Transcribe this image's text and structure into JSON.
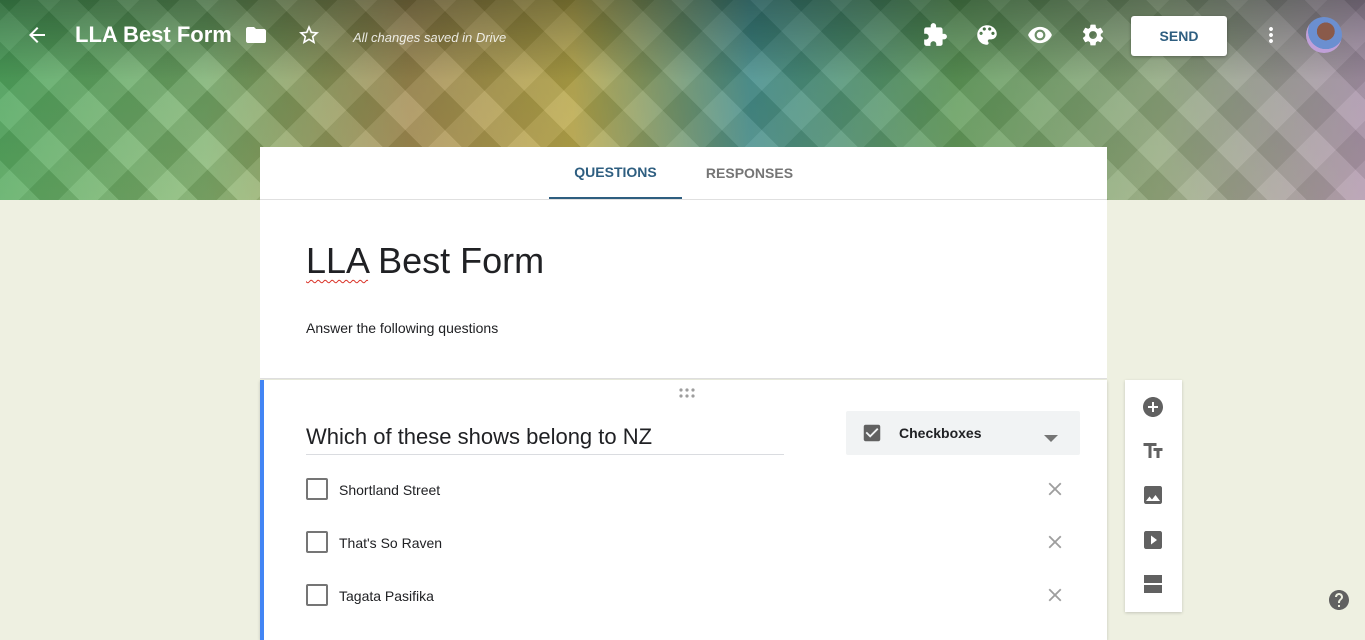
{
  "header": {
    "app_title": "LLA Best Form",
    "saved_status": "All changes saved in Drive",
    "send_label": "SEND",
    "icons": [
      "back-arrow-icon",
      "folder-icon",
      "star-icon",
      "addons-icon",
      "palette-icon",
      "preview-eye-icon",
      "settings-gear-icon",
      "more-vert-icon"
    ]
  },
  "tabs": [
    {
      "label": "QUESTIONS",
      "active": true
    },
    {
      "label": "RESPONSES",
      "active": false
    }
  ],
  "form": {
    "title_part1": "LLA",
    "title_part2": " Best Form",
    "description": "Answer the following questions"
  },
  "question": {
    "title": "Which of these shows belong to NZ",
    "type_label": "Checkboxes",
    "options": [
      {
        "label": "Shortland Street"
      },
      {
        "label": "That's So Raven"
      },
      {
        "label": "Tagata Pasifika"
      }
    ]
  },
  "toolbar": {
    "tools": [
      "add-question-icon",
      "add-title-icon",
      "add-image-icon",
      "add-video-icon",
      "add-section-icon"
    ]
  },
  "colors": {
    "accent": "#2e5e80",
    "question_highlight": "#4285f4",
    "background": "#eef0e1"
  }
}
